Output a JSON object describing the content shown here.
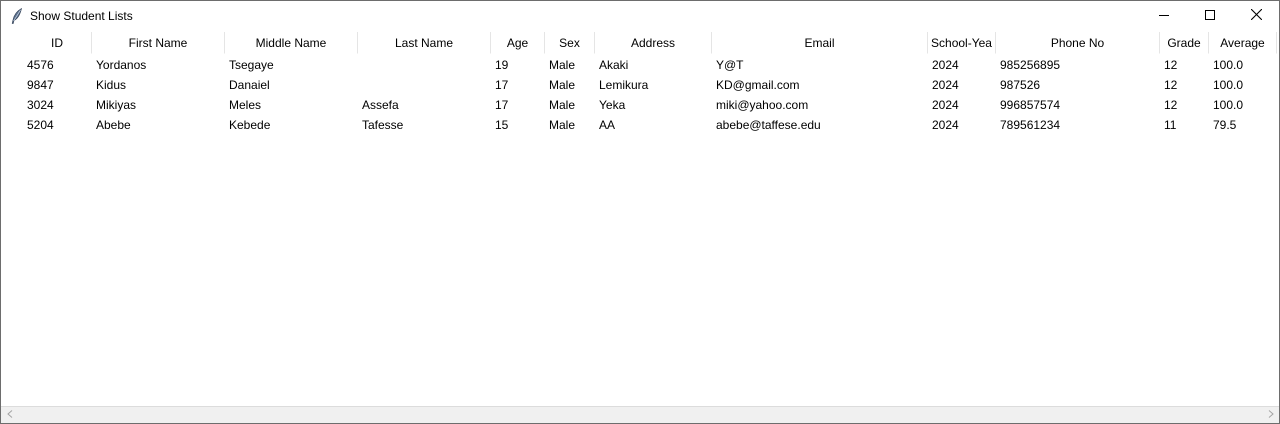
{
  "window": {
    "title": "Show Student Lists",
    "icon": "feather-icon",
    "controls": [
      "minimize-icon",
      "maximize-icon",
      "close-icon"
    ]
  },
  "table": {
    "columns": [
      "ID",
      "First Name",
      "Middle Name",
      "Last Name",
      "Age",
      "Sex",
      "Address",
      "Email",
      "School-Yea",
      "Phone No",
      "Grade",
      "Average"
    ],
    "rows": [
      [
        "4576",
        "Yordanos",
        "Tsegaye",
        "",
        "19",
        "Male",
        "Akaki",
        "Y@T",
        "2024",
        "985256895",
        "12",
        "100.0"
      ],
      [
        "9847",
        "Kidus",
        "Danaiel",
        "",
        "17",
        "Male",
        "Lemikura",
        "KD@gmail.com",
        "2024",
        "987526",
        "12",
        "100.0"
      ],
      [
        "3024",
        "Mikiyas",
        "Meles",
        "Assefa",
        "17",
        "Male",
        "Yeka",
        "miki@yahoo.com",
        "2024",
        "996857574",
        "12",
        "100.0"
      ],
      [
        "5204",
        "Abebe",
        "Kebede",
        "Tafesse",
        "15",
        "Male",
        "AA",
        "abebe@taffese.edu",
        "2024",
        "789561234",
        "11",
        "79.5"
      ]
    ]
  },
  "scrollbar": {
    "left_icon": "scroll-left-icon",
    "right_icon": "scroll-right-icon"
  }
}
